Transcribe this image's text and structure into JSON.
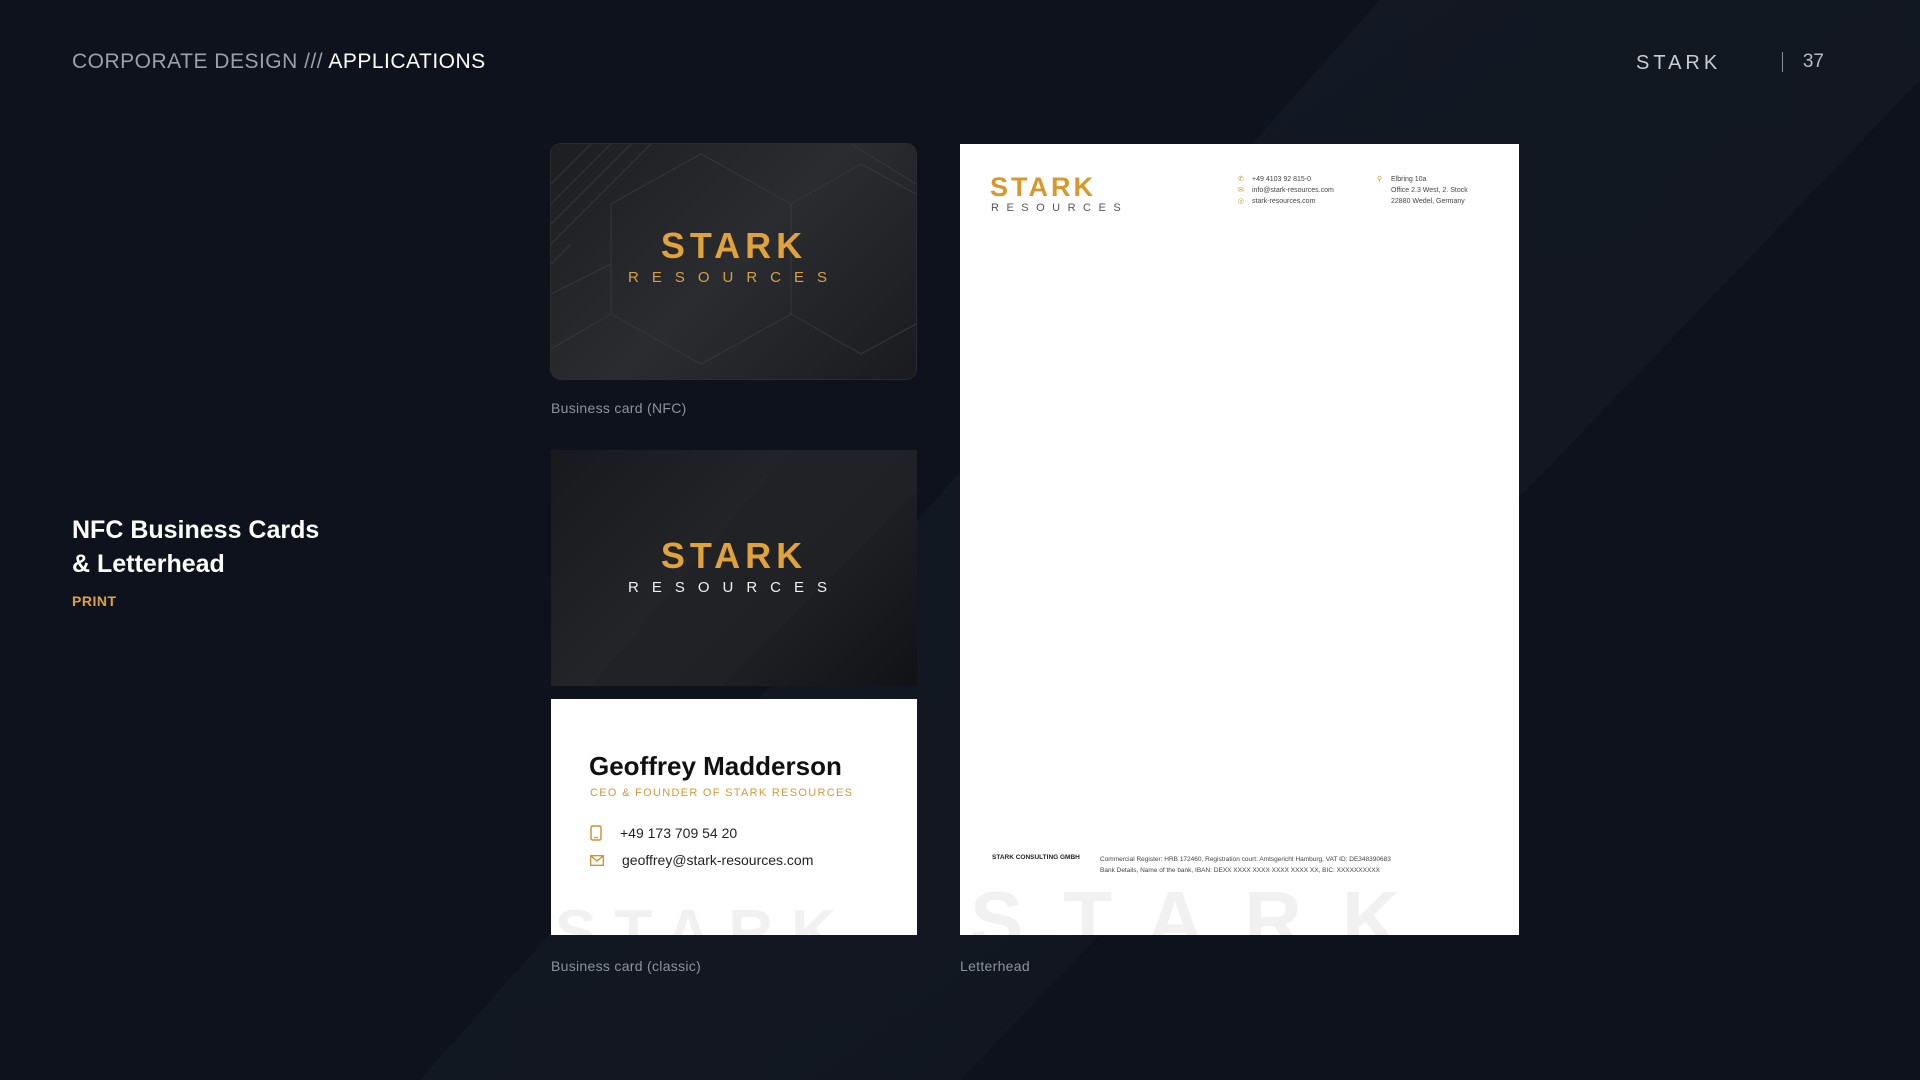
{
  "header": {
    "breadcrumb_prefix": "CORPORATE DESIGN ///",
    "breadcrumb_current": "APPLICATIONS",
    "brand_logo": "STARK",
    "page_number": "37"
  },
  "section": {
    "title_line1": "NFC Business Cards",
    "title_line2": "& Letterhead",
    "subtitle": "PRINT"
  },
  "logo": {
    "word": "STARK",
    "sub": "RESOURCES"
  },
  "captions": {
    "nfc": "Business card (NFC)",
    "classic": "Business card (classic)",
    "letterhead": "Letterhead"
  },
  "business_card": {
    "name": "Geoffrey Madderson",
    "role": "CEO & FOUNDER OF STARK RESOURCES",
    "phone": "+49 173 709 54 20",
    "email": "geoffrey@stark-resources.com"
  },
  "letterhead": {
    "phone": "+49 4103 92 815-0",
    "email": "info@stark-resources.com",
    "web": "stark-resources.com",
    "address_line1": "Elbring 10a",
    "address_line2": "Office 2.3 West, 2. Stock",
    "address_line3": "22880 Wedel, Germany",
    "footer_company": "STARK CONSULTING GMBH",
    "footer_line1": "Commercial Register: HRB 172460, Registration court: Amtsgericht Hamburg, VAT ID: DE348390683",
    "footer_line2": "Bank Details, Name of the bank, IBAN: DEXX XXXX XXXX XXXX XXXX XX, BIC: XXXXXXXXXX"
  },
  "colors": {
    "background": "#0d121c",
    "accent_gold": "#e0a33b"
  }
}
